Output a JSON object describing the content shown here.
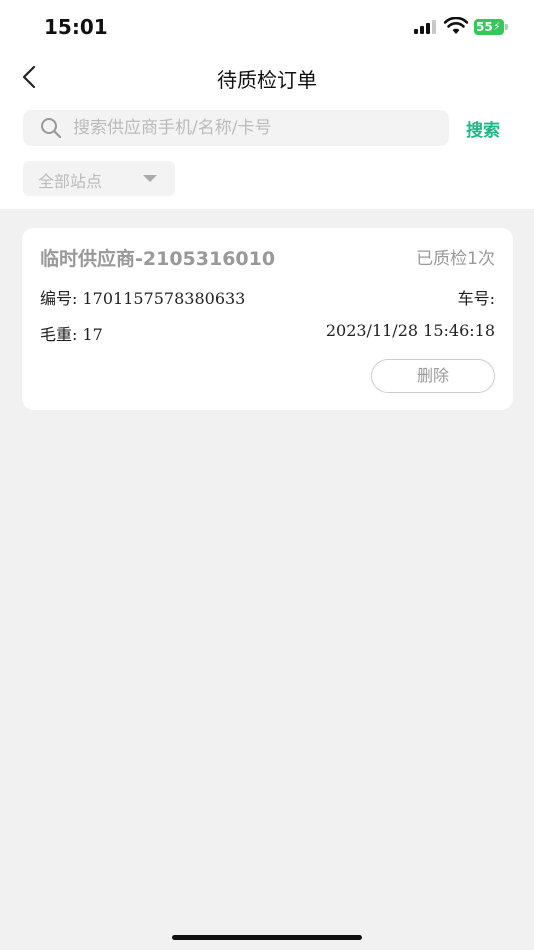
{
  "status_bar": {
    "time": "15:01",
    "battery": "55"
  },
  "nav": {
    "title": "待质检订单"
  },
  "search": {
    "placeholder": "搜索供应商手机/名称/卡号",
    "value": "",
    "button_label": "搜索"
  },
  "filter": {
    "station_label": "全部站点"
  },
  "orders": [
    {
      "supplier": "临时供应商-2105316010",
      "qc_status": "已质检1次",
      "order_no": "编号: 1701157578380633",
      "car_no": "车号:",
      "gross_weight": "毛重: 17",
      "datetime": "2023/11/28 15:46:18",
      "delete_label": "删除"
    }
  ],
  "colors": {
    "accent": "#1fb784",
    "battery": "#34c759",
    "muted_text": "#999999",
    "background": "#f1f1f1"
  },
  "icons": [
    "back-arrow-icon",
    "search-icon",
    "chevron-down-icon",
    "signal-icon",
    "wifi-icon",
    "battery-icon"
  ]
}
